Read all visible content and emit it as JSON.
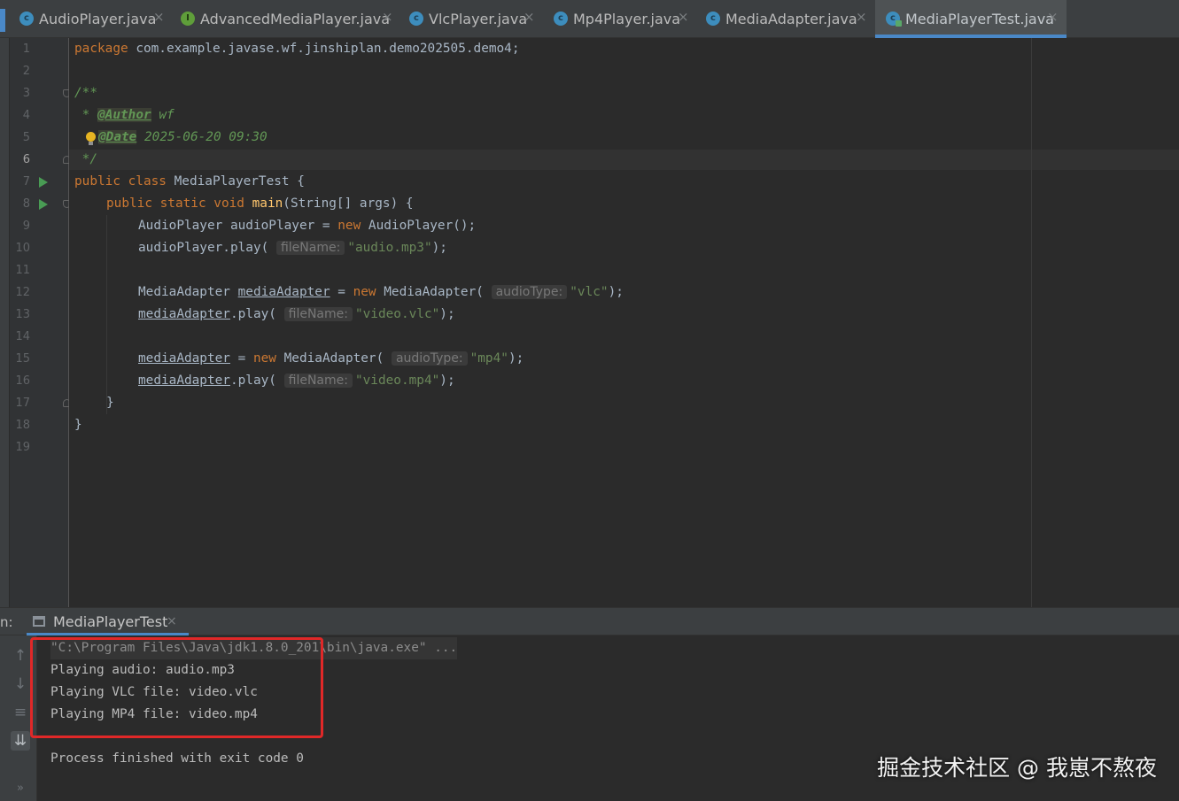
{
  "tabs": [
    {
      "label": "AudioPlayer.java",
      "icon": "class-icon"
    },
    {
      "label": "AdvancedMediaPlayer.java",
      "icon": "interface-icon"
    },
    {
      "label": "VlcPlayer.java",
      "icon": "class-icon"
    },
    {
      "label": "Mp4Player.java",
      "icon": "class-icon"
    },
    {
      "label": "MediaAdapter.java",
      "icon": "class-icon"
    },
    {
      "label": "MediaPlayerTest.java",
      "icon": "test-class-icon",
      "active": true
    }
  ],
  "editor": {
    "line_numbers": [
      "1",
      "2",
      "3",
      "4",
      "5",
      "6",
      "7",
      "8",
      "9",
      "10",
      "11",
      "12",
      "13",
      "14",
      "15",
      "16",
      "17",
      "18",
      "19"
    ],
    "current_line": "6",
    "code": {
      "l1": {
        "kw": "package",
        "text": " com.example.javase.wf.jinshiplan.demo202505.demo4;"
      },
      "l3": {
        "text": "/**"
      },
      "l4": {
        "star": " * ",
        "tag": "@Author",
        "value": " wf"
      },
      "l5": {
        "tag": "@Date",
        "value": " 2025-06-20 09:30"
      },
      "l6": {
        "text": " */"
      },
      "l7": {
        "kw": "public class",
        "text": " MediaPlayerTest {"
      },
      "l8": {
        "kw": "public static void",
        "fn": "main",
        "text": "(String[] args) {"
      },
      "l9": {
        "type": "AudioPlayer audioPlayer = ",
        "kw": "new",
        "text": " AudioPlayer();"
      },
      "l10": {
        "text": "audioPlayer.play(",
        "hint": "fileName:",
        "str": "\"audio.mp3\"",
        "end": ");"
      },
      "l12": {
        "type": "MediaAdapter ",
        "var": "mediaAdapter",
        "eq": " = ",
        "kw": "new",
        "text": " MediaAdapter(",
        "hint": "audioType:",
        "str": "\"vlc\"",
        "end": ");"
      },
      "l13": {
        "var": "mediaAdapter",
        "text": ".play(",
        "hint": "fileName:",
        "str": "\"video.vlc\"",
        "end": ");"
      },
      "l15": {
        "var": "mediaAdapter",
        "eq": " = ",
        "kw": "new",
        "text": " MediaAdapter(",
        "hint": "audioType:",
        "str": "\"mp4\"",
        "end": ");"
      },
      "l16": {
        "var": "mediaAdapter",
        "text": ".play(",
        "hint": "fileName:",
        "str": "\"video.mp4\"",
        "end": ");"
      },
      "l17": {
        "text": "}"
      },
      "l18": {
        "text": "}"
      }
    }
  },
  "run": {
    "label": "n:",
    "tab_label": "MediaPlayerTest",
    "console": [
      "\"C:\\Program Files\\Java\\jdk1.8.0_201\\bin\\java.exe\" ...",
      "Playing audio: audio.mp3",
      "Playing VLC file: video.vlc",
      "Playing MP4 file: video.mp4",
      "Process finished with exit code 0"
    ],
    "side_icons": [
      "up-arrow-icon",
      "down-arrow-icon",
      "soft-wrap-icon",
      "scroll-to-end-icon",
      "more-icon"
    ]
  },
  "watermark": "掘金技术社区 @ 我崽不熬夜",
  "close_glyph": "×",
  "colors": {
    "highlight_box": "#e02828",
    "accent": "#4a88c7",
    "keyword": "#cc7832",
    "string": "#6a8759",
    "comment": "#629755"
  }
}
